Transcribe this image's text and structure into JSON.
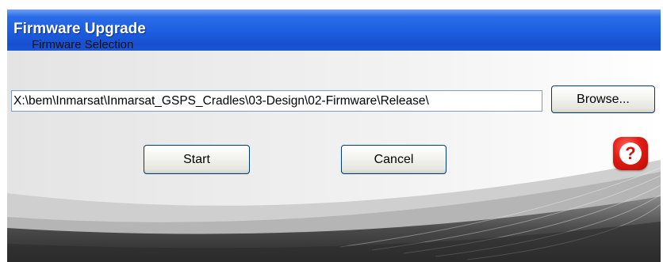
{
  "window": {
    "title": "Firmware Upgrade"
  },
  "firmware_selection": {
    "group_label": "Firmware Selection",
    "path_value": "X:\\bem\\Inmarsat\\Inmarsat_GSPS_Cradles\\03-Design\\02-Firmware\\Release\\",
    "browse_label": "Browse..."
  },
  "actions": {
    "start_label": "Start",
    "cancel_label": "Cancel"
  },
  "help": {
    "icon": "help-icon",
    "glyph": "?"
  },
  "colors": {
    "title_bar": "#1d5de0",
    "help_red": "#e21b13",
    "button_border": "#003c74"
  }
}
